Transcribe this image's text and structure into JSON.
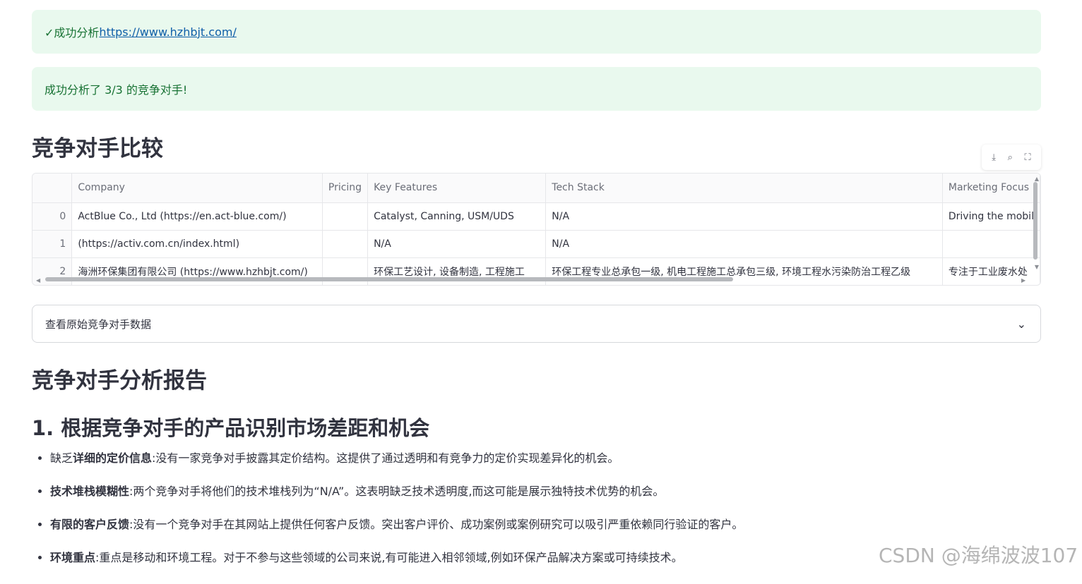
{
  "alerts": {
    "analyzed_prefix": "✓成功分析 ",
    "analyzed_url": "https://www.hzhbjt.com/",
    "summary": "成功分析了 3/3 的竞争对手!"
  },
  "comparison": {
    "title": "竞争对手比较",
    "toolbar": {
      "download": "⤓",
      "search": "⌕",
      "fullscreen": "⛶"
    },
    "columns": [
      "",
      "Company",
      "Pricing",
      "Key Features",
      "Tech Stack",
      "Marketing Focus"
    ],
    "rows": [
      {
        "index": "0",
        "company": "ActBlue Co., Ltd (https://en.act-blue.com/)",
        "pricing": "",
        "features": "Catalyst, Canning, USM/UDS",
        "tech": "N/A",
        "marketing": "Driving the mobil"
      },
      {
        "index": "1",
        "company": " (https://activ.com.cn/index.html)",
        "pricing": "",
        "features": "N/A",
        "tech": "N/A",
        "marketing": ""
      },
      {
        "index": "2",
        "company": "海洲环保集团有限公司 (https://www.hzhbjt.com/)",
        "pricing": "",
        "features": "环保工艺设计, 设备制造, 工程施工",
        "tech": "环保工程专业总承包一级, 机电工程施工总承包三级, 环境工程水污染防治工程乙级",
        "marketing": "专注于工业废水处"
      }
    ]
  },
  "expander": {
    "label": "查看原始竞争对手数据"
  },
  "report": {
    "title": "竞争对手分析报告",
    "section1_title": "1. 根据竞争对手的产品识别市场差距和机会",
    "bullets": [
      {
        "pre": "缺乏",
        "bold": "详细的定价信息",
        "text": ":没有一家竞争对手披露其定价结构。这提供了通过透明和有竞争力的定价实现差异化的机会。"
      },
      {
        "pre": "",
        "bold": "技术堆栈模糊性",
        "text": ":两个竞争对手将他们的技术堆栈列为“N/A”。这表明缺乏技术透明度,而这可能是展示独特技术优势的机会。"
      },
      {
        "pre": "",
        "bold": "有限的客户反馈",
        "text": ":没有一个竞争对手在其网站上提供任何客户反馈。突出客户评价、成功案例或案例研究可以吸引严重依赖同行验证的客户。"
      },
      {
        "pre": "",
        "bold": "环境重点",
        "text": ":重点是移动和环境工程。对于不参与这些领域的公司来说,有可能进入相邻领域,例如环保产品解决方案或可持续技术。"
      }
    ]
  },
  "watermark": "CSDN @海绵波波107"
}
